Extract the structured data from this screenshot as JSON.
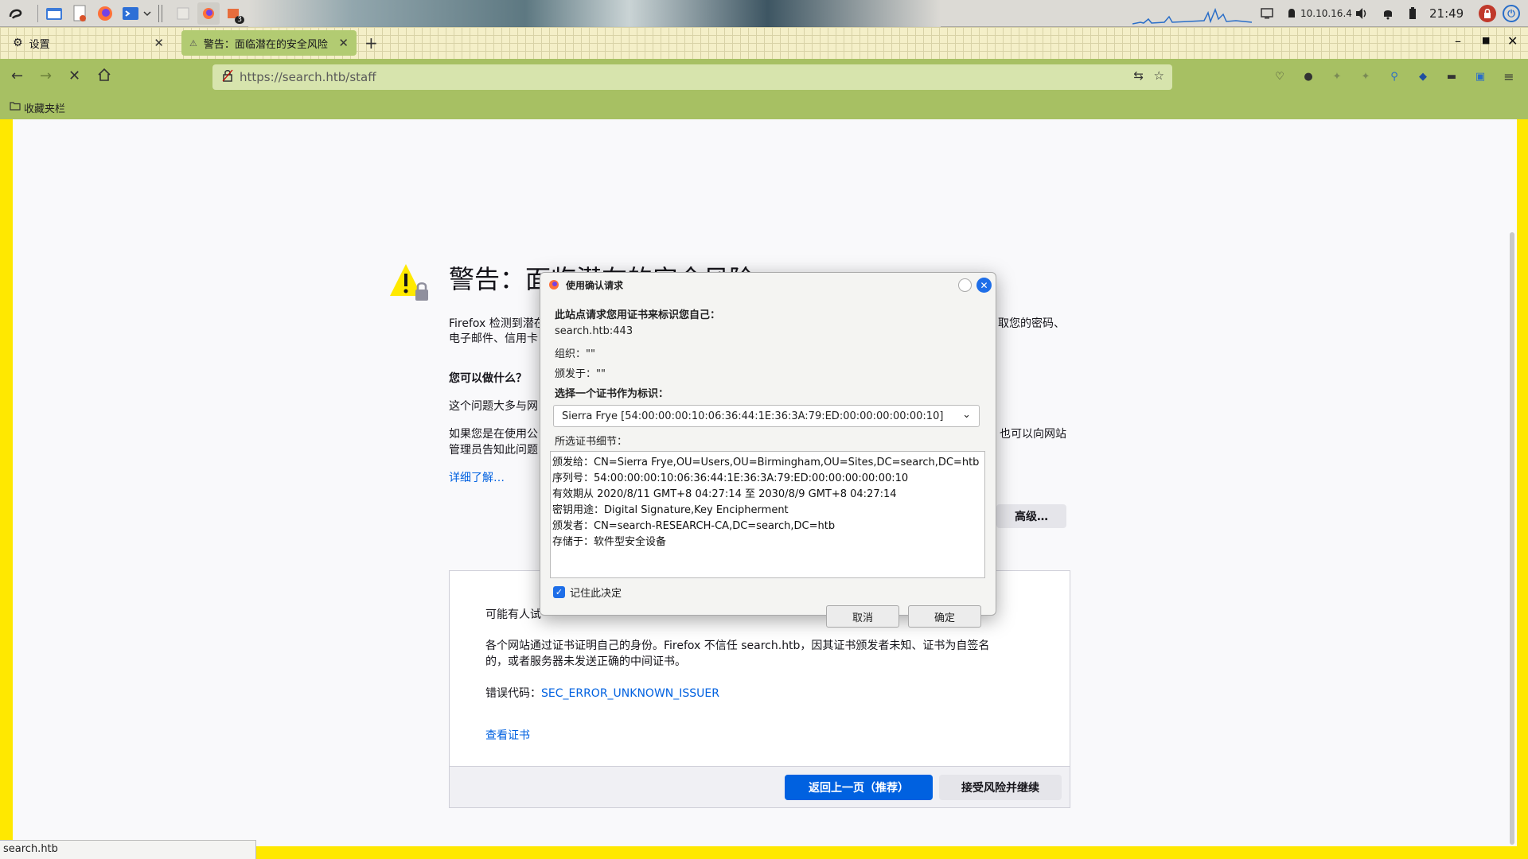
{
  "taskbar": {
    "ip": "10.10.16.4",
    "clock": "21:49",
    "badge_count": "3"
  },
  "tabs": [
    {
      "label": "设置",
      "icon": "gear-icon"
    },
    {
      "label": "警告：面临潜在的安全风险",
      "icon": "warning-icon"
    }
  ],
  "urlbar": {
    "url": "https://search.htb/staff"
  },
  "bookmarks": {
    "label": "收藏夹栏"
  },
  "page": {
    "title": "警告：面临潜在的安全风险",
    "intro_1a": "Firefox 检测到潜在",
    "intro_1b": "取您的密码、",
    "intro_2": "电子邮件、信用卡",
    "what_heading": "您可以做什么？",
    "what_1": "这个问题大多与网",
    "what_2a": "如果您是在使用公",
    "what_2b": "也可以向网站",
    "what_3": "管理员告知此问题",
    "learn_more": "详细了解…",
    "advanced_button": "高级…",
    "adv_line1": "可能有人试",
    "adv_line2": "各个网站通过证书证明自己的身份。Firefox 不信任 search.htb，因其证书颁发者未知、证书为自签名",
    "adv_line3": "的，或者服务器未发送正确的中间证书。",
    "error_code_label": "错误代码：",
    "error_code": "SEC_ERROR_UNKNOWN_ISSUER",
    "view_cert": "查看证书",
    "back_button": "返回上一页（推荐）",
    "accept_button": "接受风险并继续"
  },
  "dialog": {
    "title": "使用确认请求",
    "prompt": "此站点请求您用证书来标识您自己：",
    "host": "search.htb:443",
    "org": "组织：\"\"",
    "issued_under": "颁发于：\"\"",
    "choose_label": "选择一个证书作为标识：",
    "selected_cert": "Sierra Frye [54:00:00:00:10:06:36:44:1E:36:3A:79:ED:00:00:00:00:00:10]",
    "details_label": "所选证书细节：",
    "details": [
      "颁发给：CN=Sierra Frye,OU=Users,OU=Birmingham,OU=Sites,DC=search,DC=htb",
      "序列号：54:00:00:00:10:06:36:44:1E:36:3A:79:ED:00:00:00:00:00:10",
      "有效期从 2020/8/11 GMT+8 04:27:14 至 2030/8/9 GMT+8 04:27:14",
      "密钥用途：Digital Signature,Key Encipherment",
      "颁发者：CN=search-RESEARCH-CA,DC=search,DC=htb",
      "存储于：软件型安全设备"
    ],
    "remember": "记住此决定",
    "cancel": "取消",
    "ok": "确定"
  },
  "status_bar": "search.htb",
  "colors": {
    "tab_active": "#b2cb72",
    "navbar": "#a7c063",
    "primary_button": "#0061e0",
    "page_frame": "#ffe800"
  }
}
